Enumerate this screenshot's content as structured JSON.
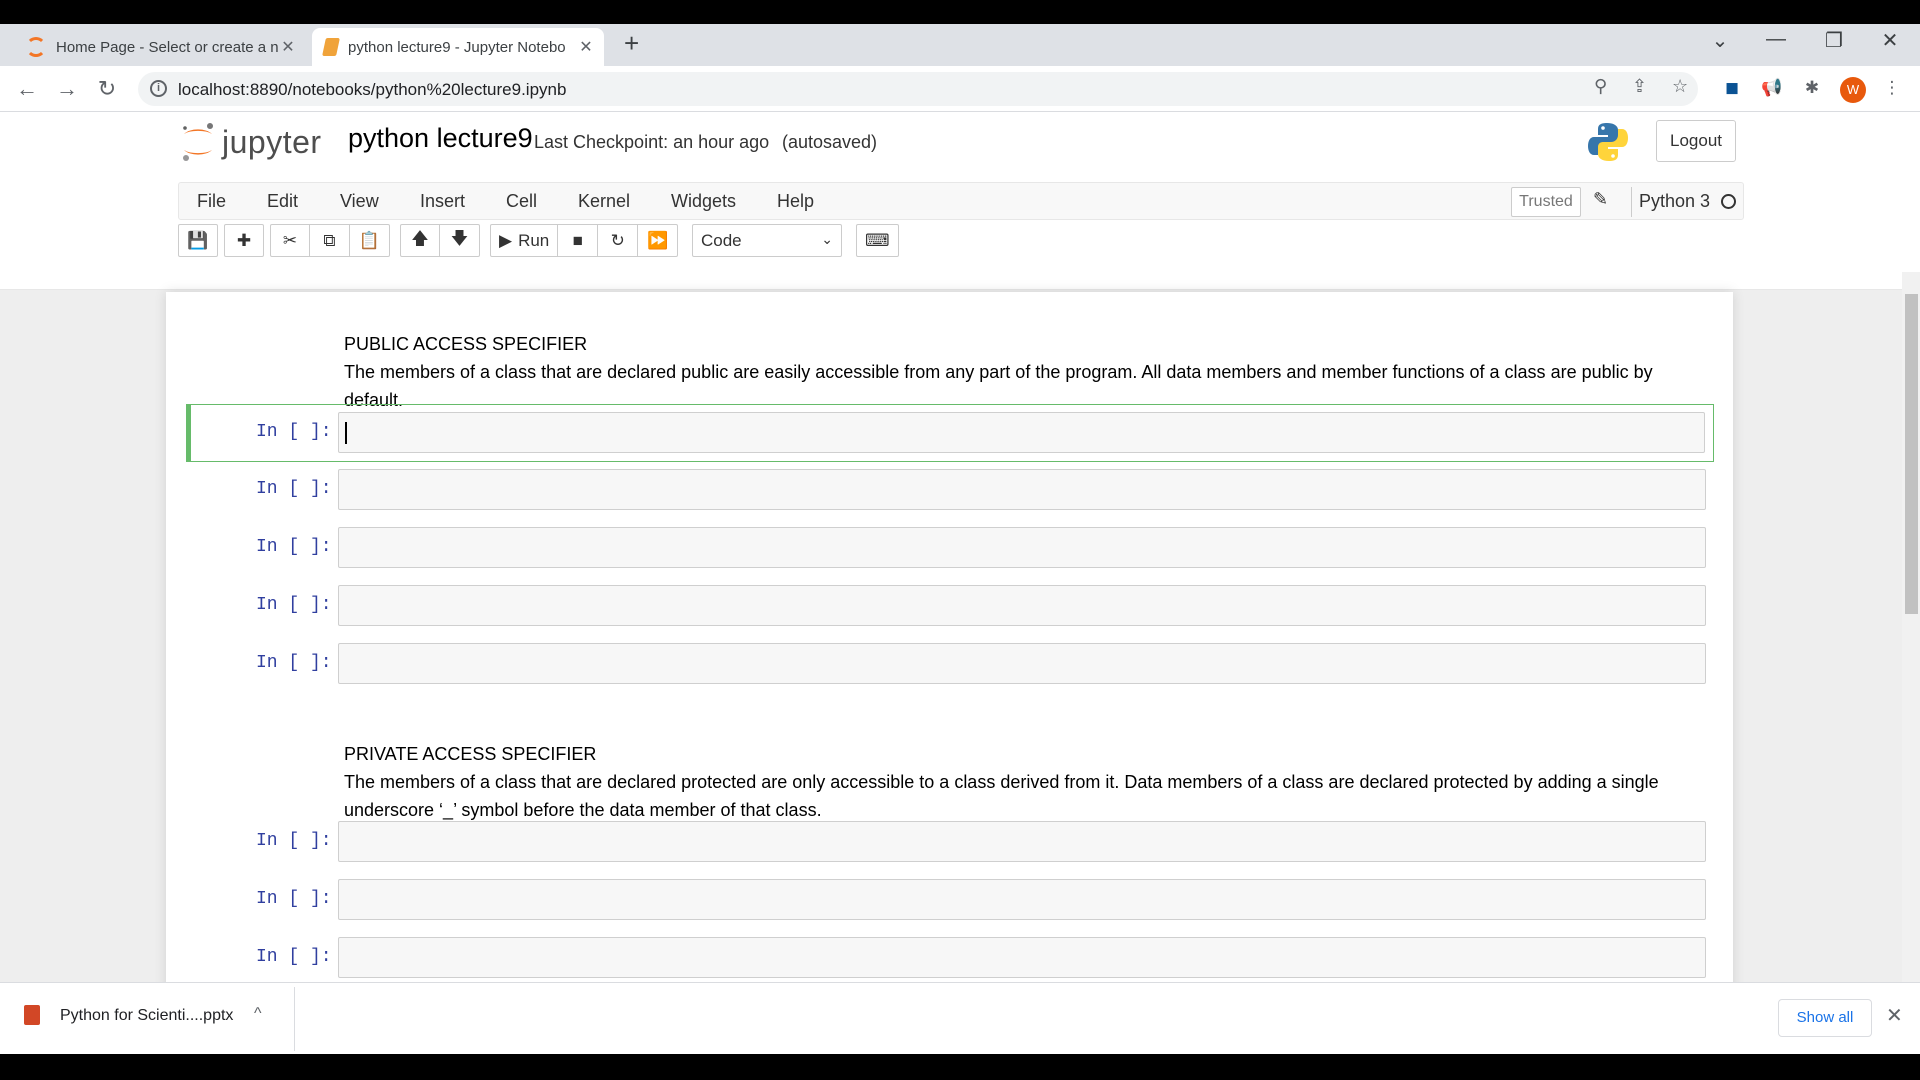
{
  "browser": {
    "tabs": [
      {
        "title": "Home Page - Select or create a n",
        "close": "✕"
      },
      {
        "title": "python lecture9 - Jupyter Notebo",
        "close": "✕"
      }
    ],
    "new_tab": "+",
    "window_controls": {
      "dropdown": "⌄",
      "minimize": "—",
      "maximize": "❐",
      "close": "✕"
    },
    "nav": {
      "back": "←",
      "forward": "→",
      "reload": "↻"
    },
    "url": "localhost:8890/notebooks/python%20lecture9.ipynb",
    "info_icon": "i",
    "omnibox_icons": {
      "zoom": "⚲",
      "share": "⇪",
      "bookmark": "☆"
    },
    "extensions": {
      "ext1": "◼",
      "ext2": "📢",
      "puzzle": "✱",
      "menu": "⋮"
    },
    "profile_initial": "W"
  },
  "jupyter": {
    "logo_text": "jupyter",
    "notebook_title": "python lecture9",
    "checkpoint": "Last Checkpoint: an hour ago",
    "autosave": "(autosaved)",
    "logout": "Logout",
    "menu": [
      "File",
      "Edit",
      "View",
      "Insert",
      "Cell",
      "Kernel",
      "Widgets",
      "Help"
    ],
    "trusted": "Trusted",
    "kernel": "Python 3",
    "toolbar": {
      "save": "💾",
      "add": "✚",
      "cut": "✂",
      "copy": "⧉",
      "paste": "📋",
      "up": "🡅",
      "down": "🡇",
      "run_icon": "▶",
      "run": "Run",
      "stop": "■",
      "restart": "↻",
      "restart_run": "⏩",
      "celltype": "Code",
      "celltype_arrow": "⌄",
      "keyboard": "⌨"
    }
  },
  "notebook": {
    "md1": {
      "heading": "PUBLIC ACCESS SPECIFIER",
      "body": "The members of a class that are declared public are easily accessible from any part of the program. All data members and member functions of a class are public by default."
    },
    "md2": {
      "heading": "PRIVATE ACCESS SPECIFIER",
      "body": "The members of a class that are declared protected are only accessible to a class derived from it. Data members of a class are declared protected by adding a single underscore ‘_’ symbol before the data member of that class."
    },
    "prompt": "In [ ]:"
  },
  "downloads": {
    "file": "Python for Scienti....pptx",
    "chevron": "^",
    "show_all": "Show all",
    "close": "✕"
  }
}
